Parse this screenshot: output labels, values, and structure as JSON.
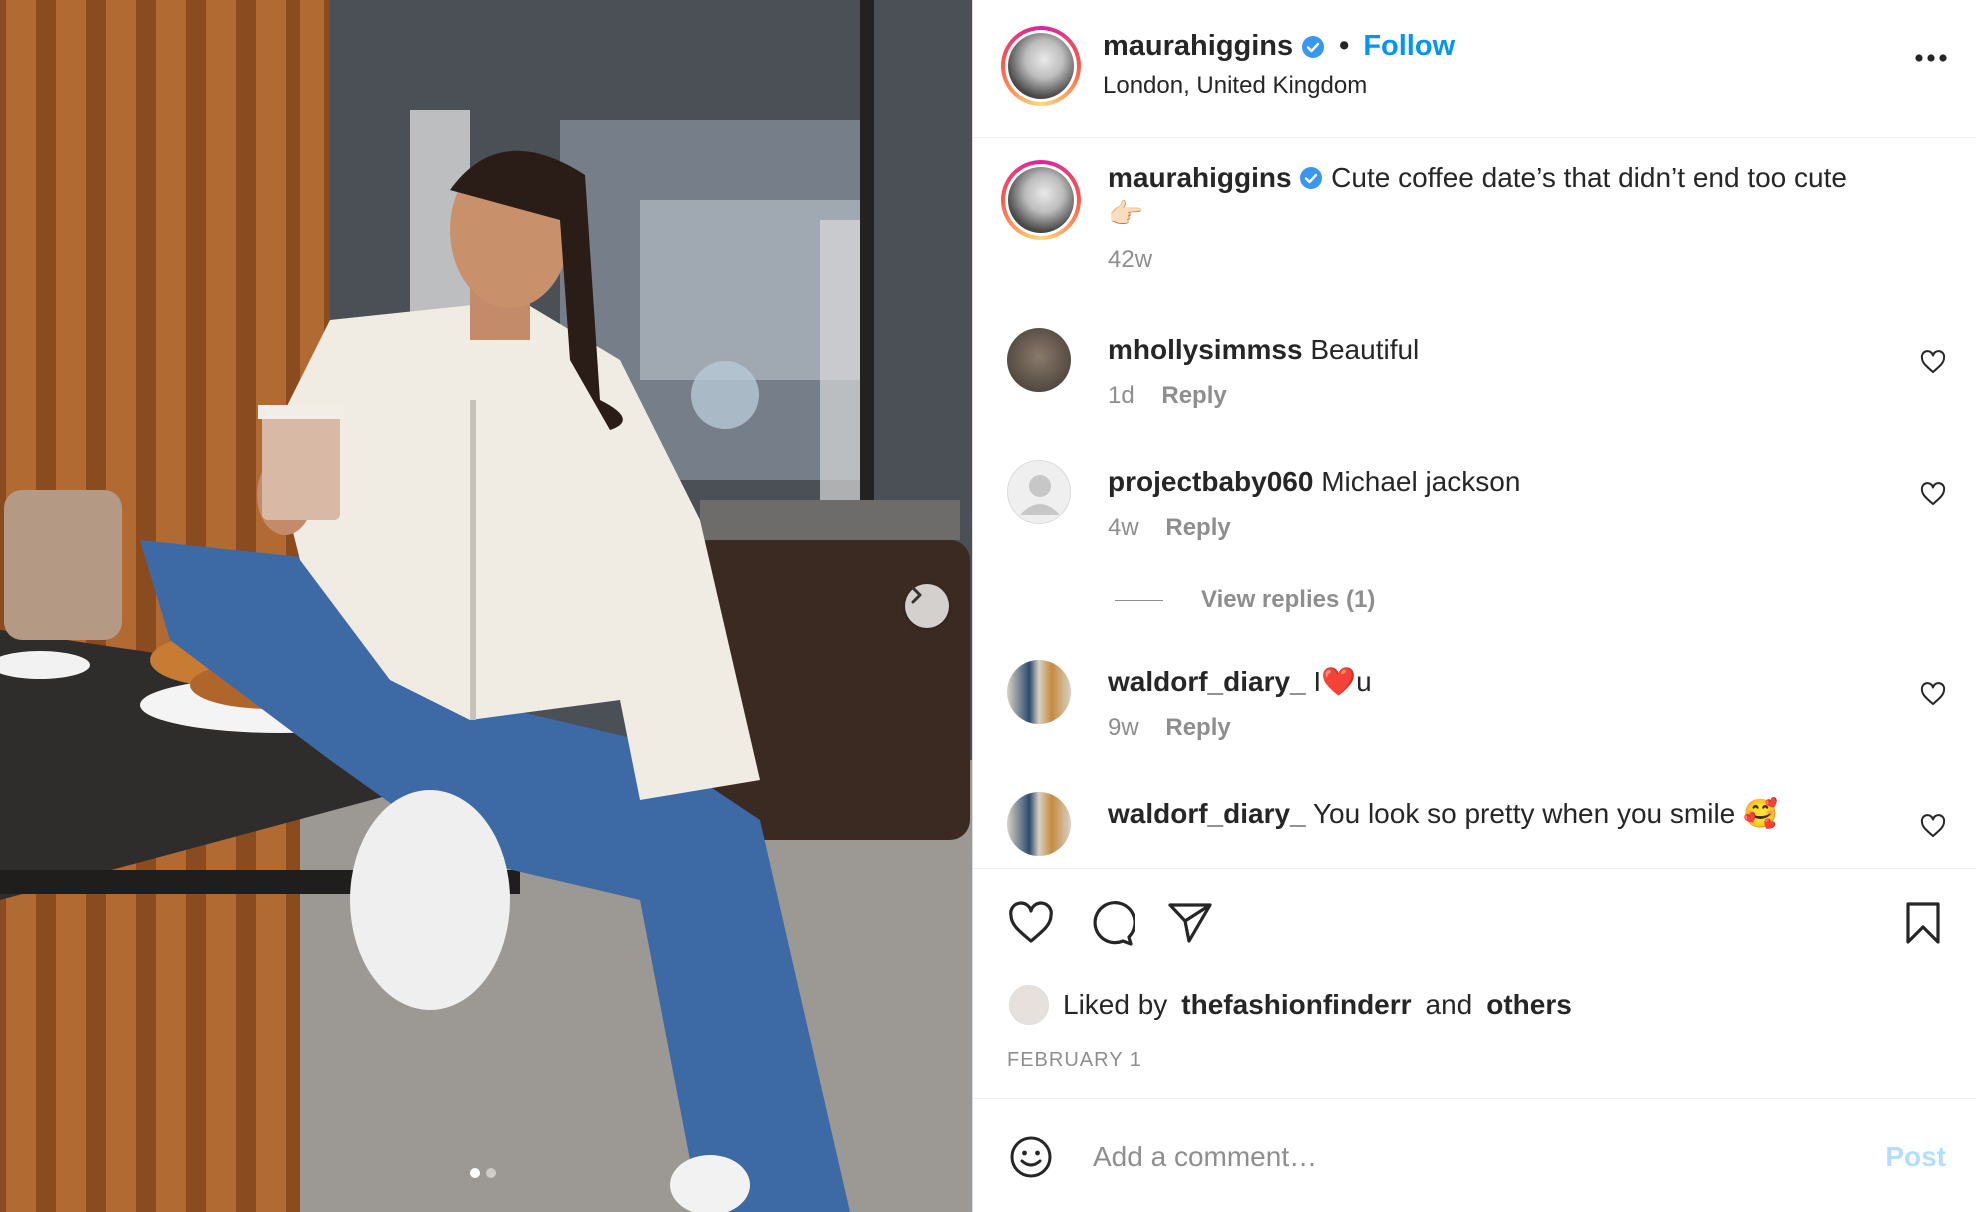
{
  "post": {
    "author": "maurahiggins",
    "separator": "•",
    "follow_label": "Follow",
    "location": "London, United Kingdom",
    "caption_text": "Cute coffee date’s that didn’t end too cute",
    "caption_emoji": "👉🏻",
    "caption_age": "42w",
    "liked_by_prefix": "Liked by",
    "liked_by_user": "thefashionfinderr",
    "liked_by_and": "and",
    "liked_by_others": "others",
    "date": "FEBRUARY 1",
    "image_count": 2,
    "current_image": 1
  },
  "comments": [
    {
      "user": "mhollysimmss",
      "text": "Beautiful",
      "age": "1d",
      "reply_label": "Reply"
    },
    {
      "user": "projectbaby060",
      "text": "Michael jackson",
      "age": "4w",
      "reply_label": "Reply",
      "view_replies": "View replies (1)"
    },
    {
      "user": "waldorf_diary_",
      "text": "I❤️u",
      "age": "9w",
      "reply_label": "Reply"
    },
    {
      "user": "waldorf_diary_",
      "text": "You look so pretty when you smile 🥰",
      "age": "",
      "reply_label": ""
    }
  ],
  "comment_box": {
    "placeholder": "Add a comment…",
    "post_label": "Post"
  },
  "colors": {
    "link_blue": "#0095f6",
    "post_disabled": "#b2dffc",
    "muted": "#8e8e8e"
  },
  "icons": {
    "verified": "verified-badge-icon",
    "more": "more-options-icon",
    "like": "heart-icon",
    "comment": "comment-icon",
    "share": "paper-plane-icon",
    "save": "bookmark-icon",
    "emoji": "emoji-icon",
    "next": "chevron-right-icon"
  }
}
